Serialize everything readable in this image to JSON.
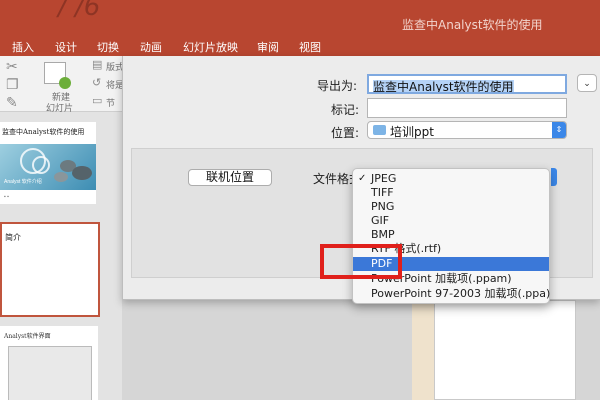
{
  "titlebar": {
    "faint_text": "/ /6",
    "doc_title": "监查中Analyst软件的使用"
  },
  "ribbon": {
    "tabs": [
      "插入",
      "设计",
      "切换",
      "动画",
      "幻灯片放映",
      "审阅",
      "视图"
    ]
  },
  "toolbar": {
    "new_slide_line1": "新建",
    "new_slide_line2": "幻灯片",
    "layout_label": "版式",
    "reset_label": "将是",
    "section_label": "节"
  },
  "slides": [
    {
      "title": "监查中Analyst软件的使用",
      "subtitle": "Analyst 软件介绍"
    },
    {
      "title": "简介"
    },
    {
      "title": "Analyst软件界面"
    }
  ],
  "dialog": {
    "export_as_label": "导出为:",
    "export_as_value": "监查中Analyst软件的使用",
    "tags_label": "标记:",
    "tags_value": "",
    "where_label": "位置:",
    "where_value": "培训ppt",
    "online_button": "联机位置",
    "format_label": "文件格式",
    "expand_icon": "chevron-down-icon"
  },
  "format_menu": {
    "items": [
      {
        "label": "JPEG",
        "checked": true
      },
      {
        "label": "TIFF"
      },
      {
        "label": "PNG"
      },
      {
        "label": "GIF"
      },
      {
        "label": "BMP"
      },
      {
        "label": "RTF 格式(.rtf)"
      },
      {
        "label": "PDF",
        "highlighted": true
      },
      {
        "label": "PowerPoint 加载项(.ppam)"
      },
      {
        "label": "PowerPoint 97-2003 加载项(.ppa)"
      }
    ]
  },
  "colors": {
    "ribbon": "#b84630",
    "highlight": "#3b78d8",
    "annotation": "#e0201b"
  }
}
